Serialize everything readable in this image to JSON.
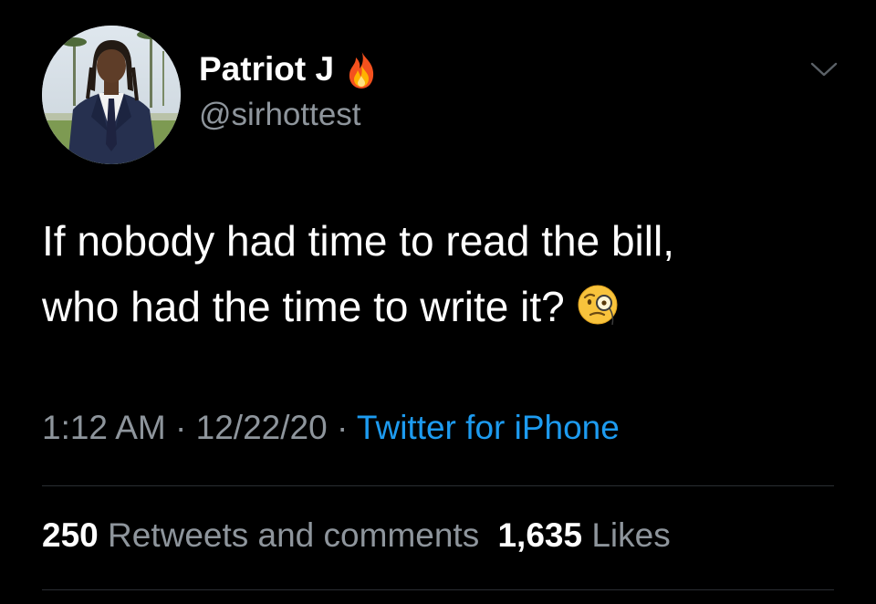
{
  "tweet": {
    "display_name": "Patriot J",
    "name_emoji": "fire-icon",
    "handle": "@sirhottest",
    "text_line_1": "If nobody had time to read the bill,",
    "text_line_2": "who had the time to write it?",
    "text_emoji": "monocle-face-icon",
    "time": "1:12 AM",
    "separator": "·",
    "date": "12/22/20",
    "source": "Twitter for iPhone",
    "retweets_count": "250",
    "retweets_label": "Retweets and comments",
    "likes_count": "1,635",
    "likes_label": "Likes"
  },
  "colors": {
    "background": "#000000",
    "primary_text": "#ffffff",
    "secondary_text": "#8e959c",
    "link": "#1d9bf0",
    "divider": "#2a2e33"
  }
}
